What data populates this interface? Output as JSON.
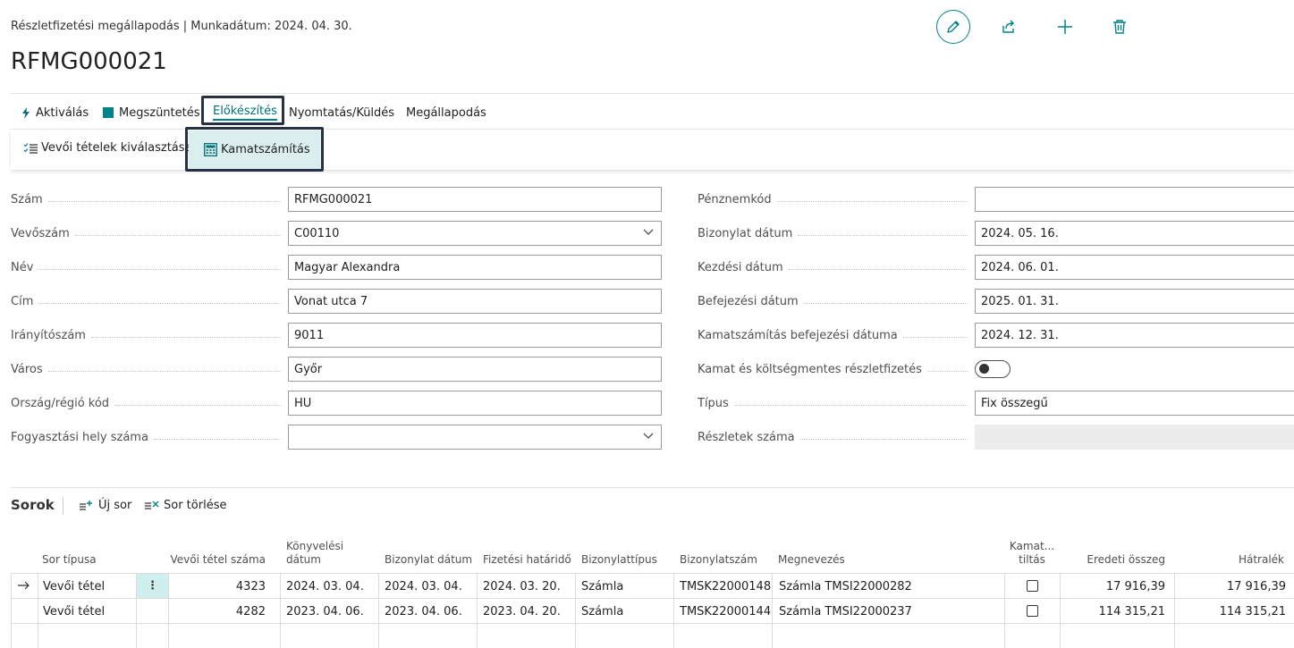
{
  "header": {
    "subtitle": "Részletfizetési megállapodás | Munkadátum: 2024. 04. 30.",
    "title": "RFMG000021"
  },
  "actions": {
    "aktivalas": "Aktiválás",
    "megszuntetes": "Megszüntetés",
    "elokeszites": "Előkészítés",
    "nyomtatas": "Nyomtatás/Küldés",
    "megallapodas": "Megállapodás"
  },
  "subactions": {
    "vevoi_tetelek": "Vevői tételek kiválasztása",
    "kamatszamitas": "Kamatszámítás"
  },
  "form": {
    "left": [
      {
        "label": "Szám",
        "value": "RFMG000021"
      },
      {
        "label": "Vevőszám",
        "value": "C00110"
      },
      {
        "label": "Név",
        "value": "Magyar Alexandra"
      },
      {
        "label": "Cím",
        "value": "Vonat utca 7"
      },
      {
        "label": "Irányítószám",
        "value": "9011"
      },
      {
        "label": "Város",
        "value": "Győr"
      },
      {
        "label": "Ország/régió kód",
        "value": "HU"
      },
      {
        "label": "Fogyasztási hely száma",
        "value": ""
      }
    ],
    "right": [
      {
        "label": "Pénznemkód",
        "value": ""
      },
      {
        "label": "Bizonylat dátum",
        "value": "2024. 05. 16."
      },
      {
        "label": "Kezdési dátum",
        "value": "2024. 06. 01."
      },
      {
        "label": "Befejezési dátum",
        "value": "2025. 01. 31."
      },
      {
        "label": "Kamatszámítás befejezési dátuma",
        "value": "2024. 12. 31."
      },
      {
        "label": "Kamat és költségmentes részletfizetés",
        "value": ""
      },
      {
        "label": "Típus",
        "value": "Fix összegű"
      },
      {
        "label": "Részletek száma",
        "value": ""
      }
    ],
    "kamatmentes_toggle": false
  },
  "lines": {
    "title": "Sorok",
    "new_line": "Új sor",
    "delete_line": "Sor törlése",
    "columns": {
      "sor_tipusa": "Sor típusa",
      "vevoi_tetel_szama": "Vevői tétel száma",
      "konyvelesi_datum_1": "Könyvelési",
      "konyvelesi_datum_2": "dátum",
      "bizonylat_datum": "Bizonylat dátum",
      "fizetesi_hatarido": "Fizetési határidő",
      "bizonylattipus": "Bizonylattípus",
      "bizonylatszam": "Bizonylatszám",
      "megnevezes": "Megnevezés",
      "kamat_tiltas_1": "Kamat...",
      "kamat_tiltas_2": "tiltás",
      "eredeti_osszeg": "Eredeti összeg",
      "hatralek": "Hátralék"
    },
    "rows": [
      {
        "sor_tipusa": "Vevői tétel",
        "vevoi_tetel_szama": "4323",
        "konyvelesi_datum": "2024. 03. 04.",
        "bizonylat_datum": "2024. 03. 04.",
        "fizetesi_hatarido": "2024. 03. 20.",
        "bizonylattipus": "Számla",
        "bizonylatszam": "TMSK22000148",
        "megnevezes": "Számla TMSI22000282",
        "kamat_tiltas": false,
        "eredeti_osszeg": "17 916,39",
        "hatralek": "17 916,39"
      },
      {
        "sor_tipusa": "Vevői tétel",
        "vevoi_tetel_szama": "4282",
        "konyvelesi_datum": "2023. 04. 06.",
        "bizonylat_datum": "2023. 04. 06.",
        "fizetesi_hatarido": "2023. 04. 20.",
        "bizonylattipus": "Számla",
        "bizonylatszam": "TMSK22000144",
        "megnevezes": "Számla TMSI22000237",
        "kamat_tiltas": false,
        "eredeti_osszeg": "114 315,21",
        "hatralek": "114 315,21"
      }
    ]
  },
  "colors": {
    "accent": "#008489",
    "highlight_border": "#263145",
    "selected_bg": "#d9eeed"
  }
}
